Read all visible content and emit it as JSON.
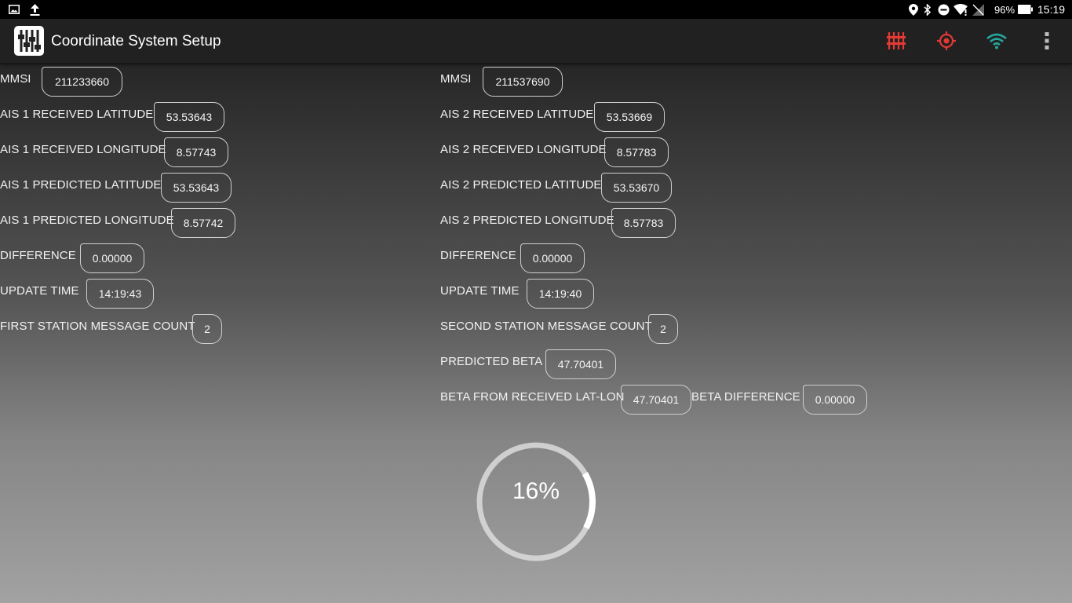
{
  "status_bar": {
    "battery": "96%",
    "time": "15:19"
  },
  "app_bar": {
    "title": "Coordinate System Setup",
    "icon_colors": {
      "equalizer": "#e53935",
      "target": "#e53935",
      "wifi": "#26a69a"
    }
  },
  "station1": {
    "mmsi_label": "MMSI",
    "mmsi": "211233660",
    "rlat_label": "AIS 1 RECEIVED LATITUDE",
    "rlat": "53.53643",
    "rlon_label": "AIS 1 RECEIVED LONGITUDE",
    "rlon": "8.57743",
    "plat_label": "AIS 1 PREDICTED LATITUDE",
    "plat": "53.53643",
    "plon_label": "AIS 1 PREDICTED LONGITUDE",
    "plon": "8.57742",
    "diff_label": "DIFFERENCE",
    "diff": "0.00000",
    "time_label": "UPDATE TIME",
    "time": "14:19:43",
    "count_label": "FIRST STATION MESSAGE COUNT",
    "count": "2"
  },
  "station2": {
    "mmsi_label": "MMSI",
    "mmsi": "211537690",
    "rlat_label": "AIS 2 RECEIVED LATITUDE",
    "rlat": "53.53669",
    "rlon_label": "AIS 2 RECEIVED LONGITUDE",
    "rlon": "8.57783",
    "plat_label": "AIS 2 PREDICTED LATITUDE",
    "plat": "53.53670",
    "plon_label": "AIS 2 PREDICTED LONGITUDE",
    "plon": "8.57783",
    "diff_label": "DIFFERENCE",
    "diff": "0.00000",
    "time_label": "UPDATE TIME",
    "time": "14:19:40",
    "count_label": "SECOND STATION MESSAGE COUNT",
    "count": "2"
  },
  "beta": {
    "predicted_label": "PREDICTED BETA",
    "predicted": "47.70401",
    "received_label": "BETA FROM RECEIVED LAT-LON",
    "received": "47.70401",
    "difference_label": "BETA DIFFERENCE",
    "difference": "0.00000"
  },
  "progress": {
    "text": "16%",
    "fraction": 0.16
  }
}
